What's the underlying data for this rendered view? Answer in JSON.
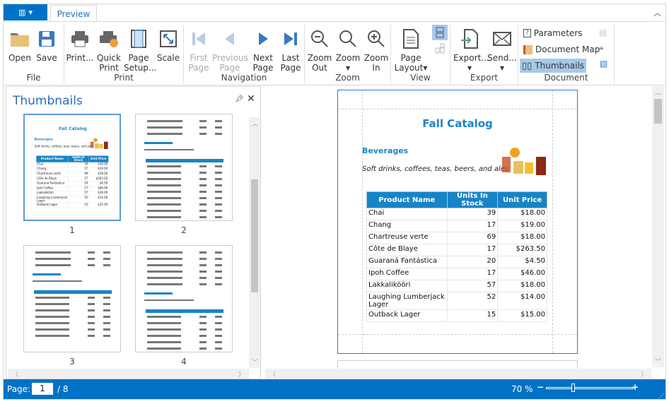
{
  "app": {
    "menu_icon": "app-menu-icon",
    "tabs": [
      {
        "label": "Preview",
        "active": true
      }
    ]
  },
  "ribbon": {
    "groups": [
      {
        "label": "File",
        "buttons": [
          {
            "label": "Open",
            "icon": "folder-icon"
          },
          {
            "label": "Save",
            "icon": "save-icon"
          }
        ]
      },
      {
        "label": "Print",
        "buttons": [
          {
            "label": "Print...",
            "icon": "printer-icon"
          },
          {
            "label": "Quick\nPrint",
            "icon": "quick-print-icon"
          },
          {
            "label": "Page\nSetup...",
            "icon": "page-setup-icon"
          },
          {
            "label": "Scale",
            "icon": "scale-icon"
          }
        ]
      },
      {
        "label": "Navigation",
        "buttons": [
          {
            "label": "First\nPage",
            "icon": "first-page-icon",
            "disabled": true
          },
          {
            "label": "Previous\nPage",
            "icon": "previous-page-icon",
            "disabled": true
          },
          {
            "label": "Next\nPage",
            "icon": "next-page-icon"
          },
          {
            "label": "Last\nPage",
            "icon": "last-page-icon"
          }
        ]
      },
      {
        "label": "Zoom",
        "buttons": [
          {
            "label": "Zoom\nOut",
            "icon": "zoom-out-icon"
          },
          {
            "label": "Zoom",
            "icon": "zoom-icon"
          },
          {
            "label": "Zoom\nIn",
            "icon": "zoom-in-icon"
          }
        ]
      },
      {
        "label": "View",
        "buttons": [
          {
            "label": "Page\nLayout",
            "icon": "page-layout-icon"
          }
        ]
      },
      {
        "label": "Export",
        "buttons": [
          {
            "label": "Export...",
            "icon": "export-icon"
          },
          {
            "label": "Send...",
            "icon": "send-icon"
          }
        ]
      },
      {
        "label": "Document",
        "buttons": [
          {
            "label": "Parameters",
            "icon": "parameters-icon"
          },
          {
            "label": "Document Map",
            "icon": "document-map-icon"
          },
          {
            "label": "Thumbnails",
            "icon": "thumbnails-icon",
            "active": true
          }
        ]
      }
    ]
  },
  "thumbnails": {
    "title": "Thumbnails",
    "pages": [
      "1",
      "2",
      "3",
      "4"
    ],
    "selected": "1"
  },
  "document": {
    "title": "Fall Catalog",
    "category": "Beverages",
    "description": "Soft drinks, coffees, teas, beers, and ales",
    "columns": [
      "Product Name",
      "Units In Stock",
      "Unit Price"
    ],
    "rows": [
      [
        "Chai",
        "39",
        "$18.00"
      ],
      [
        "Chang",
        "17",
        "$19.00"
      ],
      [
        "Chartreuse verte",
        "69",
        "$18.00"
      ],
      [
        "Côte de Blaye",
        "17",
        "$263.50"
      ],
      [
        "Guaraná Fantástica",
        "20",
        "$4.50"
      ],
      [
        "Ipoh Coffee",
        "17",
        "$46.00"
      ],
      [
        "Lakkalikööri",
        "57",
        "$18.00"
      ],
      [
        "Laughing Lumberjack Lager",
        "52",
        "$14.00"
      ],
      [
        "Outback Lager",
        "15",
        "$15.00"
      ]
    ]
  },
  "status": {
    "page_label": "Page:",
    "page_value": "1",
    "page_total": "/ 8",
    "zoom": "70 %",
    "zoom_fraction": 0.3
  },
  "colors": {
    "accent": "#0072c6",
    "header": "#1784c7",
    "selected": "#a6c9ea"
  }
}
